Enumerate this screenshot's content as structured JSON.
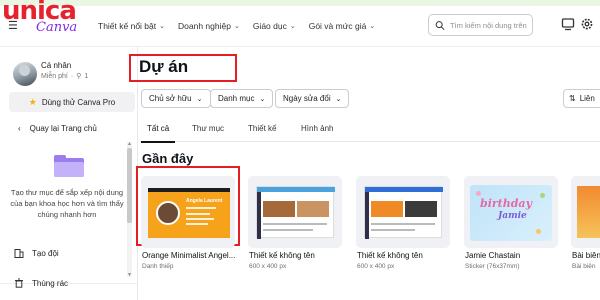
{
  "brand": {
    "unica": "unica",
    "canva": "Canva"
  },
  "topnav": [
    {
      "label": "Thiết kế nổi bật"
    },
    {
      "label": "Doanh nghiệp"
    },
    {
      "label": "Giáo dục"
    },
    {
      "label": "Gói và mức giá"
    }
  ],
  "search": {
    "placeholder": "Tìm kiếm nội dung trên"
  },
  "sidebar": {
    "user_name": "Cá nhân",
    "user_plan": "Miễn phí",
    "user_count": "1",
    "try_pro": "Dùng thử Canva Pro",
    "back": "Quay lại Trang chủ",
    "empty_text": "Tạo thư mục để sắp xếp nội dung của bạn khoa học hơn và tìm thấy chúng nhanh hơn",
    "team": "Tạo đội",
    "trash": "Thùng rác"
  },
  "main": {
    "title": "Dự án",
    "filters": [
      "Chủ sở hữu",
      "Danh mục",
      "Ngày sửa đổi"
    ],
    "sort": "Liên",
    "tabs": [
      "Tất cả",
      "Thư mục",
      "Thiết kế",
      "Hình ảnh"
    ],
    "section": "Gần đây",
    "cards": [
      {
        "name": "Orange Minimalist Angel...",
        "sub": "Danh thiếp"
      },
      {
        "name": "Thiết kế không tên",
        "sub": "600 x 400 px"
      },
      {
        "name": "Thiết kế không tên",
        "sub": "600 x 400 px"
      },
      {
        "name": "Jamie Chastain",
        "sub": "Sticker (76x37mm)"
      },
      {
        "name": "Bài biên",
        "sub": "Bài biên"
      }
    ],
    "card_text": {
      "bc_name": "Angela Laurent",
      "sticker_1": "birthday",
      "sticker_2": "Jamie"
    }
  },
  "colors": {
    "accent": "#7d2ae8",
    "brand_red": "#e8212e",
    "highlight": "#e31e24"
  }
}
